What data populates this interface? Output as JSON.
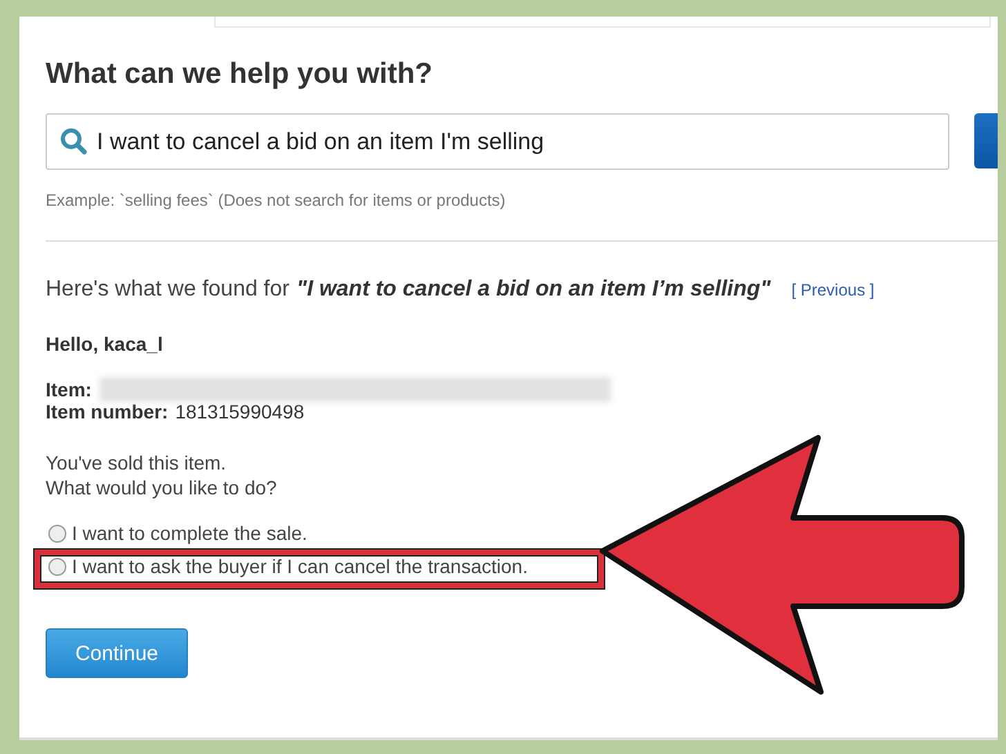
{
  "heading": "What can we help you with?",
  "search": {
    "value": "I want to cancel a bid on an item I'm selling"
  },
  "hint": "Example: `selling fees` (Does not search for items or products)",
  "results": {
    "prefix": "Here's what we found for",
    "query": "\"I want to cancel a bid on an item I’m selling\"",
    "previous_link": "[ Previous ]"
  },
  "greeting": "Hello, kaca_l",
  "item_label": "Item:",
  "item_number_label": "Item number:",
  "item_number": "181315990498",
  "message": [
    "You've sold this item.",
    "What would you like to do?"
  ],
  "options": [
    {
      "label": "I want to complete the sale.",
      "selected": false,
      "highlighted": false
    },
    {
      "label": "I want to ask the buyer if I can cancel the transaction.",
      "selected": false,
      "highlighted": true
    }
  ],
  "continue_button": "Continue"
}
